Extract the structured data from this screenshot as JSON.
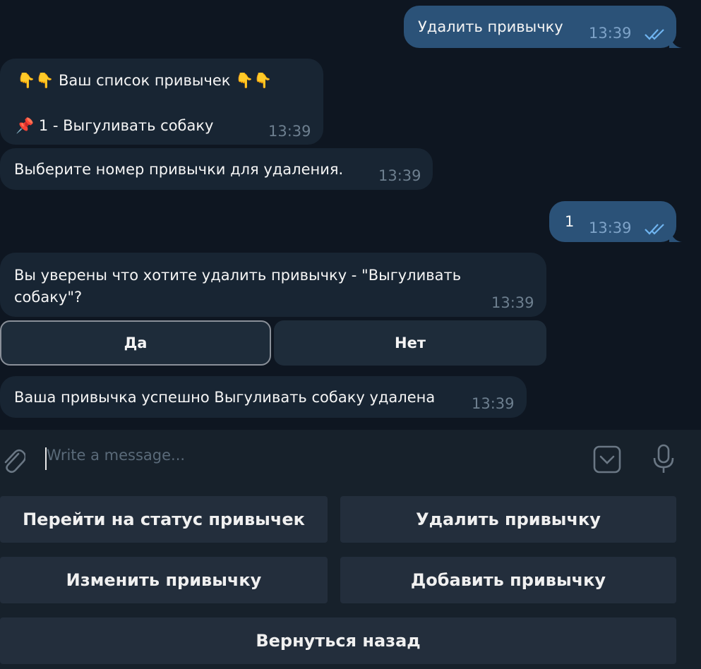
{
  "messages": {
    "m1": {
      "text": "Удалить привычку",
      "time": "13:39"
    },
    "m2": {
      "line1": "👇👇 Ваш список привычек 👇👇",
      "line2": "📌 1 - Выгуливать собаку",
      "time": "13:39"
    },
    "m3": {
      "text": "Выберите номер привычки для удаления.",
      "time": "13:39"
    },
    "m4": {
      "text": "1",
      "time": "13:39"
    },
    "m5": {
      "line1": "Вы уверены что хотите удалить привычку - \"Выгуливать",
      "line2": "собаку\"?",
      "time": "13:39"
    },
    "m6": {
      "text": "Ваша привычка успешно Выгуливать собаку удалена",
      "time": "13:39"
    }
  },
  "inline_buttons": {
    "yes": "Да",
    "no": "Нет"
  },
  "composer": {
    "placeholder": "Write a message..."
  },
  "keyboard": {
    "status": "Перейти на статус привычек",
    "delete": "Удалить привычку",
    "edit": "Изменить привычку",
    "add": "Добавить привычку",
    "back": "Вернуться назад"
  },
  "colors": {
    "background": "#0e1621",
    "incoming_bubble": "#182533",
    "outgoing_bubble": "#2b5278",
    "read_ticks": "#6fb4f0"
  }
}
